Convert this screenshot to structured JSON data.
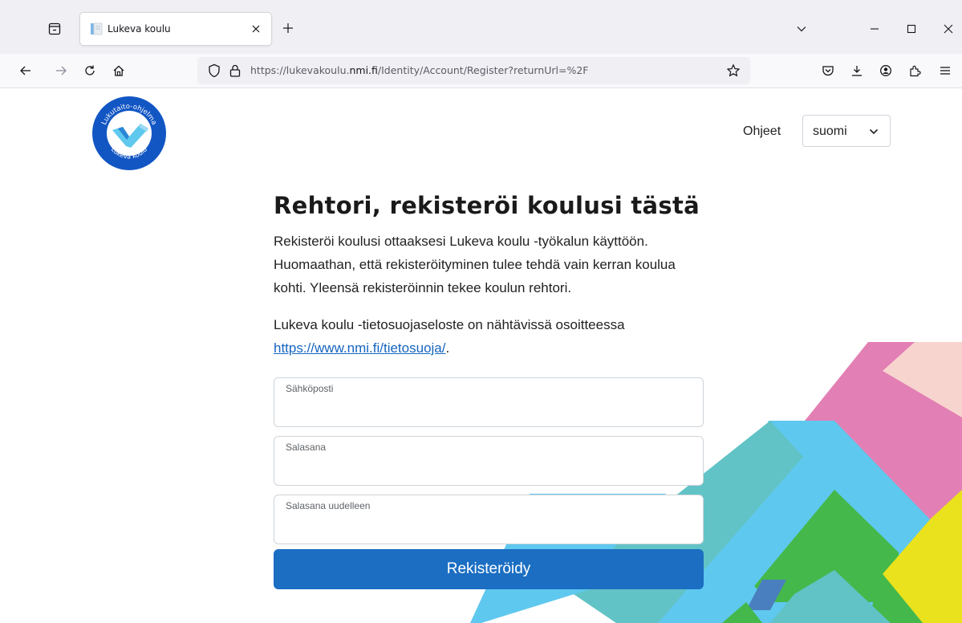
{
  "browser": {
    "tab_title": "Lukeva koulu",
    "url_prefix": "https://lukevakoulu.",
    "url_domain": "nmi.fi",
    "url_path": "/Identity/Account/Register?returnUrl=%2F"
  },
  "header": {
    "logo_text_top": "Lukutaito-ohjelma",
    "logo_text_bottom": "Lukeva koulu",
    "help_link": "Ohjeet",
    "language_selected": "suomi"
  },
  "main": {
    "heading": "Rehtori, rekisteröi koulusi tästä",
    "intro": "Rekisteröi koulusi ottaaksesi Lukeva koulu -työkalun käyttöön. Huomaathan, että rekisteröityminen tulee tehdä vain kerran koulua kohti. Yleensä rekisteröinnin tekee koulun rehtori.",
    "privacy_text": "Lukeva koulu -tietosuojaseloste on nähtävissä osoitteessa",
    "privacy_link": "https://www.nmi.fi/tietosuoja/",
    "privacy_suffix": "."
  },
  "form": {
    "email_label": "Sähköposti",
    "email_value": "",
    "password_label": "Salasana",
    "password_value": "",
    "password_confirm_label": "Salasana uudelleen",
    "password_confirm_value": "",
    "submit_label": "Rekisteröidy"
  },
  "colors": {
    "accent": "#1b6ec2",
    "logo_blue": "#1256c4",
    "decor_pink": "#e27fb4",
    "decor_peach": "#f8d4cf",
    "decor_sky": "#5fc8ee",
    "decor_teal": "#61c3c6",
    "decor_green": "#44b84a",
    "decor_yellow": "#eae21c"
  }
}
